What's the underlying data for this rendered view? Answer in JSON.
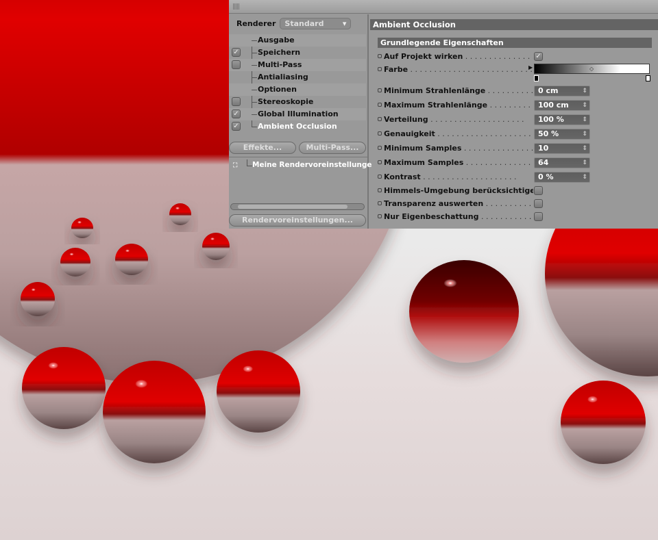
{
  "window": {
    "renderer_label": "Renderer",
    "renderer_value": "Standard"
  },
  "tree": [
    {
      "label": "Ausgabe",
      "checkbox": null
    },
    {
      "label": "Speichern",
      "checkbox": true
    },
    {
      "label": "Multi-Pass",
      "checkbox": false
    },
    {
      "label": "Antialiasing",
      "checkbox": null
    },
    {
      "label": "Optionen",
      "checkbox": null
    },
    {
      "label": "Stereoskopie",
      "checkbox": false
    },
    {
      "label": "Global Illumination",
      "checkbox": true
    },
    {
      "label": "Ambient Occlusion",
      "checkbox": true,
      "selected": true
    }
  ],
  "buttons": {
    "effects": "Effekte...",
    "multipass": "Multi-Pass...",
    "presets": "Rendervoreinstellungen..."
  },
  "preset": "Meine Rendervoreinstellunge",
  "panel": {
    "title": "Ambient Occlusion",
    "section": "Grundlegende Eigenschaften",
    "auf_projekt": "Auf Projekt wirken",
    "farbe": "Farbe",
    "fields": [
      {
        "label": "Minimum Strahlenlänge",
        "value": "0 cm"
      },
      {
        "label": "Maximum Strahlenlänge",
        "value": "100 cm"
      },
      {
        "label": "Verteilung",
        "value": "100 %"
      },
      {
        "label": "Genauigkeit",
        "value": "50 %"
      },
      {
        "label": "Minimum Samples",
        "value": "10"
      },
      {
        "label": "Maximum Samples",
        "value": "64"
      },
      {
        "label": "Kontrast",
        "value": "0 %"
      }
    ],
    "checks": [
      {
        "label": "Himmels-Umgebung berücksichtigen",
        "checked": false
      },
      {
        "label": "Transparenz auswerten",
        "checked": false
      },
      {
        "label": "Nur Eigenbeschattung",
        "checked": false
      }
    ]
  },
  "colors": {
    "accent_red": "#d00000",
    "panel": "#999999",
    "header": "#646464"
  }
}
